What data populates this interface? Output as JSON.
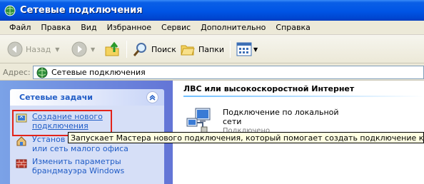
{
  "window": {
    "title": "Сетевые подключения"
  },
  "menu": [
    "Файл",
    "Правка",
    "Вид",
    "Избранное",
    "Сервис",
    "Дополнительно",
    "Справка"
  ],
  "toolbar": {
    "back_label": "Назад",
    "search_label": "Поиск",
    "folders_label": "Папки"
  },
  "address": {
    "label": "Адрес:",
    "value": "Сетевые подключения"
  },
  "tasks_panel": {
    "title": "Сетевые задачи",
    "items": [
      {
        "label": "Создание нового\nподключения",
        "icon": "new-connection-icon"
      },
      {
        "label": "Установ\nили сеть малого офиса",
        "icon": "home-network-icon"
      },
      {
        "label": "Изменить параметры\nбрандмауэра Windows",
        "icon": "firewall-icon"
      }
    ]
  },
  "content": {
    "section_title": "ЛВС или высокоскоростной Интернет",
    "connection": {
      "name": "Подключение по локальной\nсети",
      "status": "Подключено"
    }
  },
  "tooltip": "Запускает Мастера нового подключения, который помогает создать подключение к Интернету",
  "colors": {
    "titlebar": "#0055e5",
    "link": "#215dc6",
    "highlight_box": "#e2231a",
    "tooltip_bg": "#ffffe1"
  }
}
